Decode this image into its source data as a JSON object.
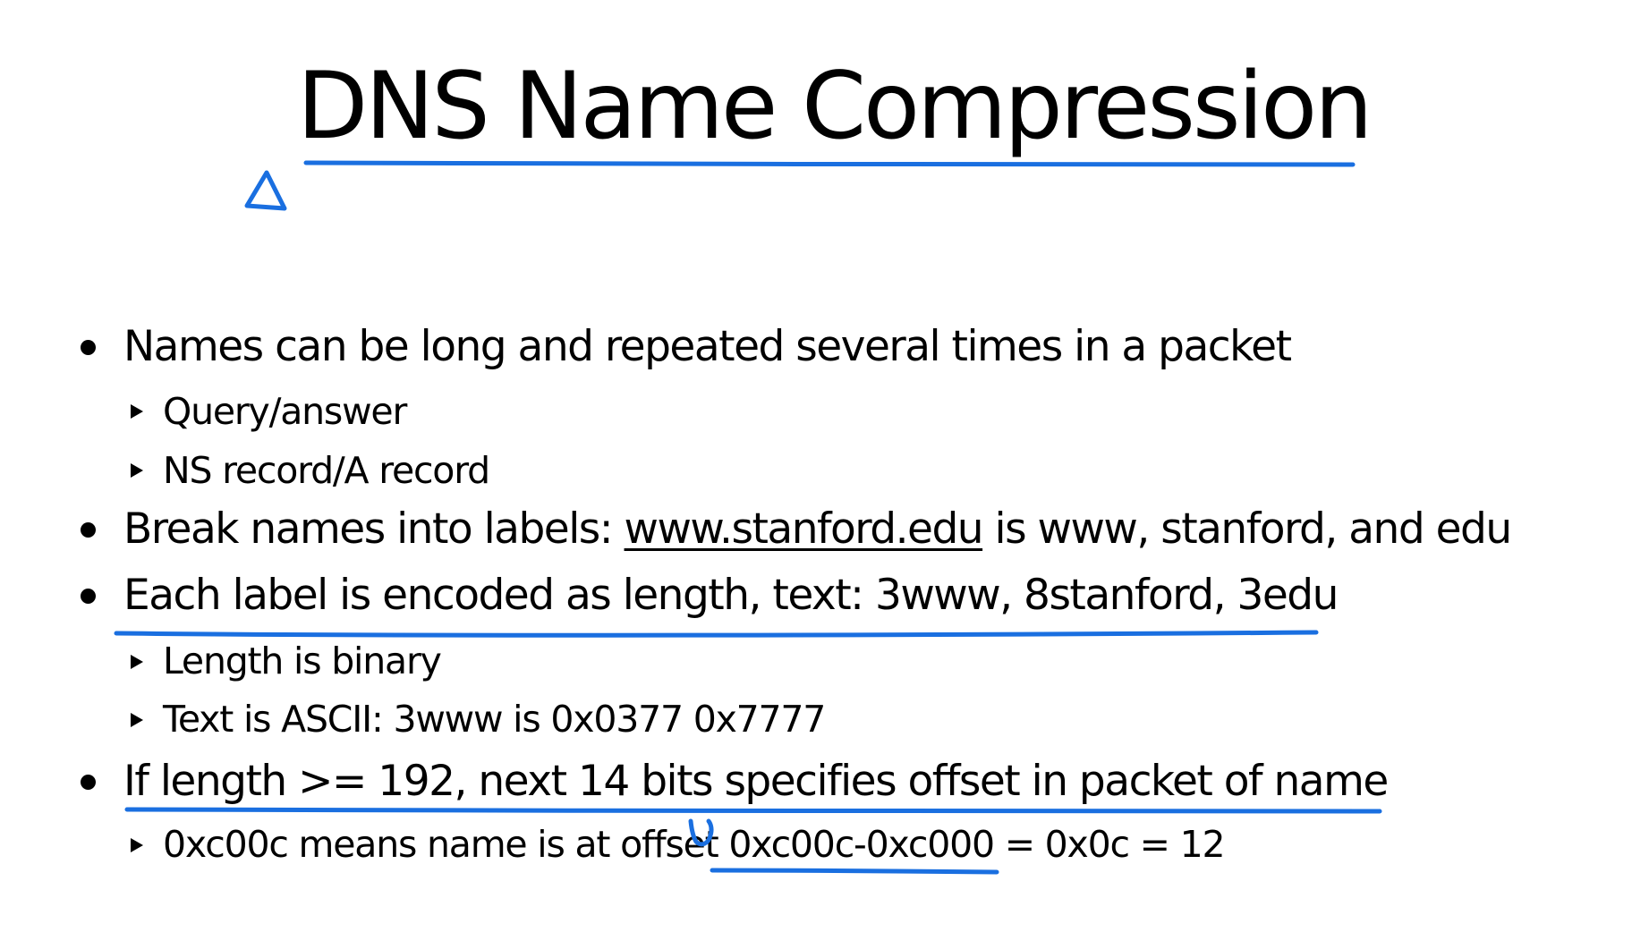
{
  "title": "DNS Name Compression",
  "bullets": [
    {
      "text": "Names can be long and repeated several times in a packet",
      "sub": [
        "Query/answer",
        "NS record/A record"
      ]
    },
    {
      "before": "Break names into labels: ",
      "link": "www.stanford.edu",
      "after": " is www, stanford, and edu"
    },
    {
      "text": "Each label is encoded as length, text: 3www, 8stanford, 3edu",
      "sub": [
        "Length is binary",
        "Text is ASCII: 3www is 0x0377 0x7777"
      ]
    },
    {
      "text": "If length >= 192, next 14 bits specifies offset in packet of name",
      "sub": [
        "0xc00c means name is at offset 0xc00c-0xc000 = 0x0c = 12"
      ]
    }
  ],
  "annotation_color": "#1a6fe0"
}
